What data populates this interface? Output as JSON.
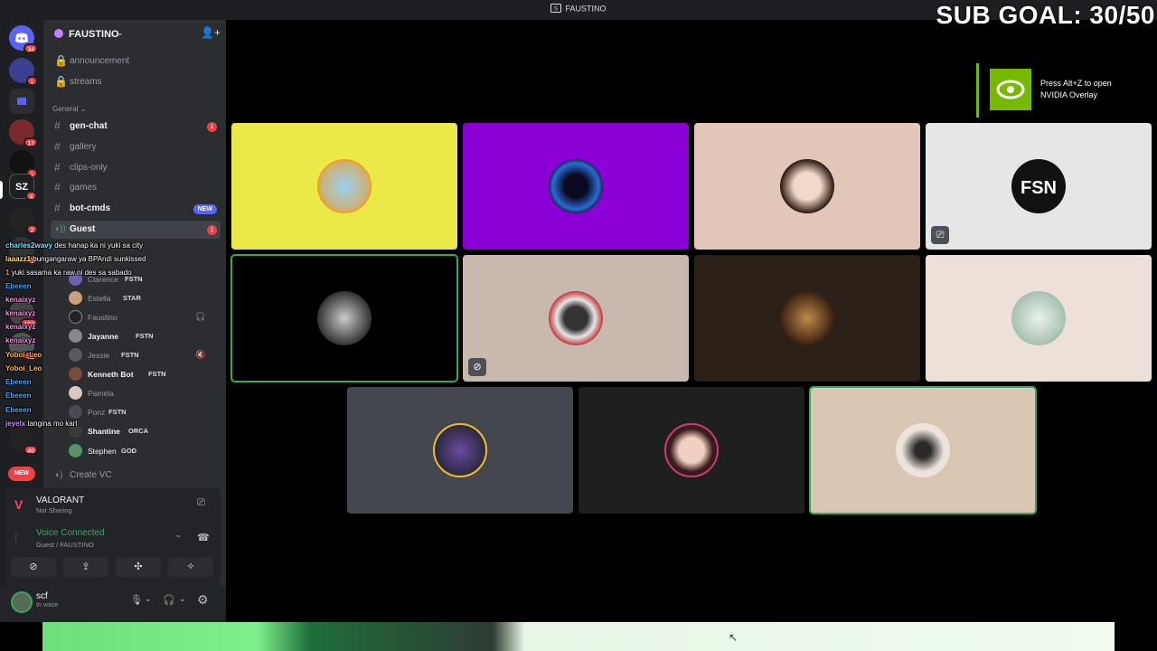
{
  "window": {
    "title": "FAUSTINO"
  },
  "overlay": {
    "sub_goal": "SUB GOAL: 30/50"
  },
  "rail": {
    "badges": [
      "34",
      "1",
      "17",
      "1",
      "4",
      "2",
      "1",
      "103",
      "28",
      "46"
    ],
    "new_label": "NEW"
  },
  "server": {
    "name": "FAUSTINO"
  },
  "channels": {
    "announcement": "announcement",
    "streams": "streams",
    "category_general": "General",
    "gen_chat": "gen-chat",
    "gen_chat_count": "1",
    "gallery": "gallery",
    "clips_only": "clips-only",
    "games": "games",
    "bot_cmds": "bot-cmds",
    "bot_cmds_badge": "NEW",
    "guest": "Guest",
    "guest_count": "1",
    "create_vc": "Create VC"
  },
  "members": [
    {
      "name": "Clarence",
      "tag": "FSTN"
    },
    {
      "name": "Estella",
      "tag": "STAR"
    },
    {
      "name": "Faustino",
      "tag": ""
    },
    {
      "name": "Jayanne",
      "tag": "FSTN"
    },
    {
      "name": "Jessie",
      "tag": "FSTN"
    },
    {
      "name": "Kenneth Bot",
      "tag": "FSTN"
    },
    {
      "name": "Pamela",
      "tag": ""
    },
    {
      "name": "Ponz",
      "tag": "FSTN"
    },
    {
      "name": "Shantine",
      "tag": "ORCA"
    },
    {
      "name": "Stephen",
      "tag": "GOD"
    }
  ],
  "chat": [
    {
      "user": "charles2wavy",
      "msg": "des hanap ka ni yuki sa city",
      "color": "#7ee3ff"
    },
    {
      "user": "laaazz1",
      "msg": "bungangaraw ya BPAndi sunkissed",
      "color": "#ffe66b"
    },
    {
      "user": "1",
      "msg": "yuki sasama ka raw ni des sa sabado",
      "color": "#ff6b6b"
    },
    {
      "user": "Ebeeen",
      "msg": "",
      "color": "#4aa3ff"
    },
    {
      "user": "kenaixyz",
      "msg": "",
      "color": "#ff8cf0"
    },
    {
      "user": "kenaixyz",
      "msg": "",
      "color": "#ff8cf0"
    },
    {
      "user": "kenaixyz",
      "msg": "",
      "color": "#ff8cf0"
    },
    {
      "user": "kenaixyz",
      "msg": "",
      "color": "#ff8cf0"
    },
    {
      "user": "Yoboi_Leo",
      "msg": "",
      "color": "#ffb347"
    },
    {
      "user": "Yoboi_Leo",
      "msg": "",
      "color": "#ffb347"
    },
    {
      "user": "Ebeeen",
      "msg": "",
      "color": "#4aa3ff"
    },
    {
      "user": "Ebeeen",
      "msg": "",
      "color": "#4aa3ff"
    },
    {
      "user": "Ebeeen",
      "msg": "",
      "color": "#4aa3ff"
    },
    {
      "user": "jeyelx",
      "msg": "tangina mo karl",
      "color": "#c98cff"
    }
  ],
  "activity": {
    "game": "VALORANT",
    "status": "Not Sharing",
    "voice_status": "Voice Connected",
    "voice_location": "Guest / FAUSTINO"
  },
  "user": {
    "name": "scf",
    "status": "In voice"
  },
  "nvidia": {
    "line1": "Press Alt+Z to open",
    "line2": "NVIDIA Overlay"
  },
  "tiles": {
    "colors": [
      "#ebe84a",
      "#8b00d6",
      "#e2c6b8",
      "#e6e6e6",
      "#000000",
      "#c9b8ae",
      "#2a2018",
      "#ece0d8",
      "#45474f",
      "#1f1f1f",
      "#d9c6b3"
    ]
  },
  "colors": {
    "accent": "#5865f2",
    "voice_green": "#3ba55c",
    "danger": "#f23f43",
    "nvidia": "#76b900"
  }
}
